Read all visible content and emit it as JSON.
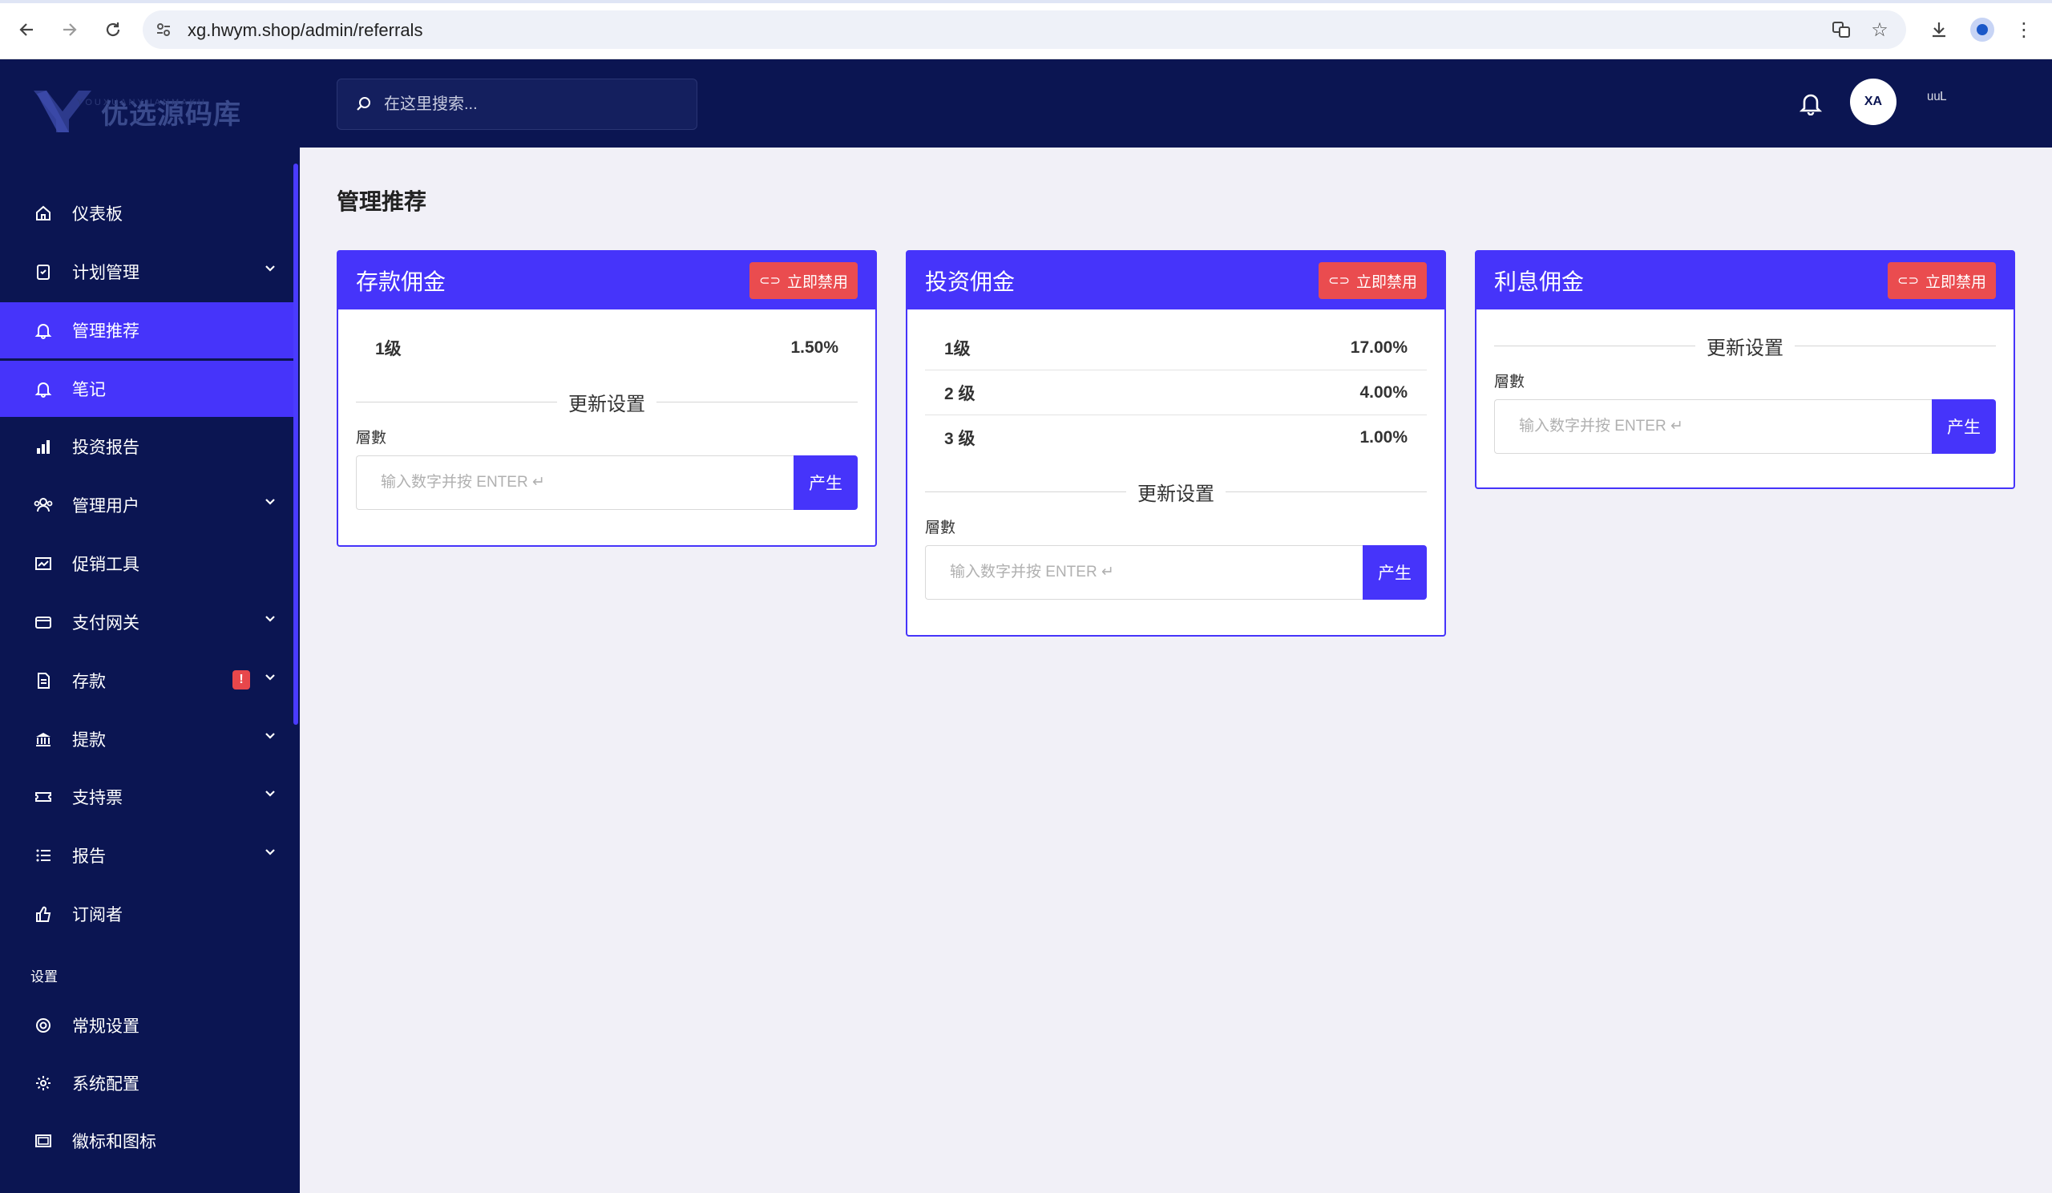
{
  "browser": {
    "url": "xg.hwym.shop/admin/referrals"
  },
  "logo": {
    "name": "优选源码库",
    "sub": "YOUXUANYUANMAKU"
  },
  "header": {
    "search_placeholder": "在这里搜索...",
    "avatar_text": "XA",
    "user_name": "ᵘᵘᴸ"
  },
  "sidebar": {
    "items": [
      {
        "label": "仪表板",
        "icon": "home-icon"
      },
      {
        "label": "计划管理",
        "icon": "clipboard-icon"
      },
      {
        "label": "管理推荐",
        "icon": "bell-icon"
      },
      {
        "label": "笔记",
        "icon": "bell-icon"
      },
      {
        "label": "投资报告",
        "icon": "bar-chart-icon"
      },
      {
        "label": "管理用户",
        "icon": "users-icon"
      },
      {
        "label": "促销工具",
        "icon": "chart-box-icon"
      },
      {
        "label": "支付网关",
        "icon": "card-icon"
      },
      {
        "label": "存款",
        "icon": "document-icon",
        "badge": "!"
      },
      {
        "label": "提款",
        "icon": "bank-icon"
      },
      {
        "label": "支持票",
        "icon": "ticket-icon"
      },
      {
        "label": "报告",
        "icon": "list-icon"
      },
      {
        "label": "订阅者",
        "icon": "thumbs-up-icon"
      }
    ],
    "section_label": "设置",
    "settings_items": [
      {
        "label": "常规设置",
        "icon": "life-ring-icon"
      },
      {
        "label": "系统配置",
        "icon": "gear-icon"
      },
      {
        "label": "徽标和图标",
        "icon": "image-icon"
      }
    ]
  },
  "main": {
    "title": "管理推荐",
    "cards": [
      {
        "title": "存款佣金",
        "disable_label": "立即禁用",
        "levels": [
          {
            "label": "1级",
            "value": "1.50%"
          }
        ],
        "update_label": "更新设置",
        "field_label": "層數",
        "input_placeholder": "输入数字并按 ENTER ↵",
        "generate_label": "产生"
      },
      {
        "title": "投资佣金",
        "disable_label": "立即禁用",
        "levels": [
          {
            "label": "1级",
            "value": "17.00%"
          },
          {
            "label": "2 级",
            "value": "4.00%"
          },
          {
            "label": "3 级",
            "value": "1.00%"
          }
        ],
        "update_label": "更新设置",
        "field_label": "層數",
        "input_placeholder": "输入数字并按 ENTER ↵",
        "generate_label": "产生"
      },
      {
        "title": "利息佣金",
        "disable_label": "立即禁用",
        "levels": [],
        "update_label": "更新设置",
        "field_label": "層數",
        "input_placeholder": "输入数字并按 ENTER ↵",
        "generate_label": "产生"
      }
    ]
  },
  "colors": {
    "sidebar_bg": "#0b1552",
    "accent": "#4634fa",
    "danger": "#ea4c4f",
    "page_bg": "#f1f0f7"
  }
}
